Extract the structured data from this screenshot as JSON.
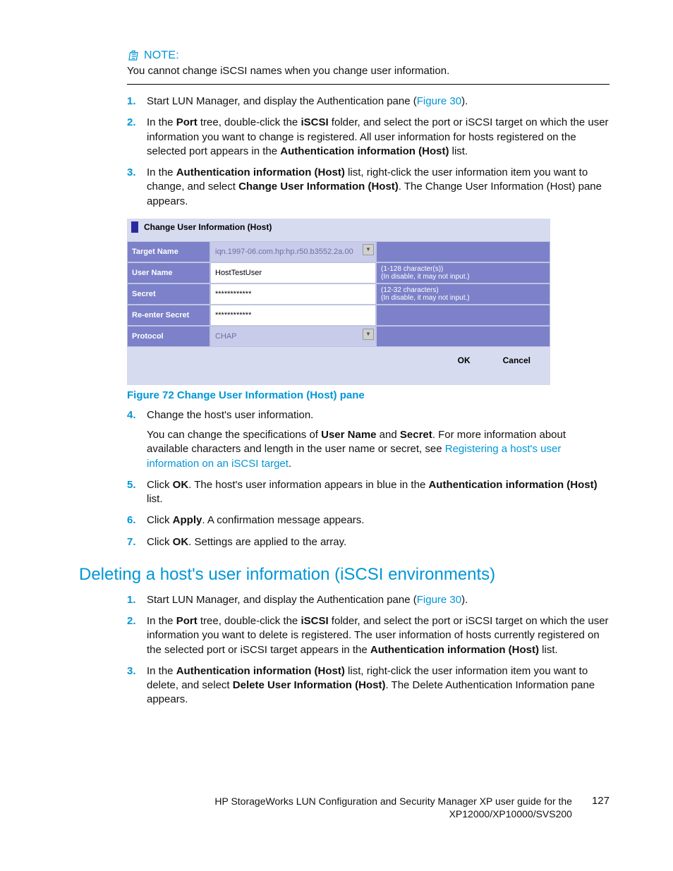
{
  "note": {
    "label": "NOTE:",
    "body": "You cannot change iSCSI names when you change user information."
  },
  "steps1": [
    {
      "num": "1.",
      "pre": "Start LUN Manager, and display the Authentication pane (",
      "link": "Figure 30",
      "post": ")."
    },
    {
      "num": "2.",
      "pre": "In the ",
      "b1": "Port",
      "mid1": " tree, double-click the ",
      "b2": "iSCSI",
      "mid2": " folder, and select the port or iSCSI target on which the user information you want to change is registered. All user information for hosts registered on the selected port appears in the ",
      "b3": "Authentication information (Host)",
      "post": " list."
    },
    {
      "num": "3.",
      "pre": "In the ",
      "b1": "Authentication information (Host)",
      "mid1": " list, right-click the user information item you want to change, and select ",
      "b2": "Change User Information (Host)",
      "post": ". The Change User Information (Host) pane appears."
    }
  ],
  "figure": {
    "title": "Change User Information (Host)",
    "rows": {
      "targetName": {
        "label": "Target Name",
        "value": "iqn.1997-06.com.hp:hp.r50.b3552.2a.00"
      },
      "userName": {
        "label": "User Name",
        "value": "HostTestUser",
        "hint1": "(1-128 character(s))",
        "hint2": "(In disable, it may not input.)"
      },
      "secret": {
        "label": "Secret",
        "value": "************",
        "hint1": "(12-32 characters)",
        "hint2": "(In disable, it may not input.)"
      },
      "reenter": {
        "label": "Re-enter Secret",
        "value": "************"
      },
      "protocol": {
        "label": "Protocol",
        "value": "CHAP"
      }
    },
    "ok": "OK",
    "cancel": "Cancel",
    "caption": "Figure 72 Change User Information (Host) pane"
  },
  "steps2": [
    {
      "num": "4.",
      "text": "Change the host's user information.",
      "p2_pre": "You can change the specifications of ",
      "p2_b1": "User Name",
      "p2_mid": " and ",
      "p2_b2": "Secret",
      "p2_mid2": ". For more information about available characters and length in the user name or secret, see ",
      "p2_link": "Registering a host's user information on an iSCSI target",
      "p2_post": "."
    },
    {
      "num": "5.",
      "pre": "Click ",
      "b1": "OK",
      "mid": ". The host's user information appears in blue in the ",
      "b2": "Authentication information (Host)",
      "post": " list."
    },
    {
      "num": "6.",
      "pre": "Click ",
      "b1": "Apply",
      "post": ". A confirmation message appears."
    },
    {
      "num": "7.",
      "pre": "Click ",
      "b1": "OK",
      "post": ". Settings are applied to the array."
    }
  ],
  "section2_title": "Deleting a host's user information (iSCSI environments)",
  "steps3": [
    {
      "num": "1.",
      "pre": "Start LUN Manager, and display the Authentication pane (",
      "link": "Figure 30",
      "post": ")."
    },
    {
      "num": "2.",
      "pre": "In the ",
      "b1": "Port",
      "mid1": " tree, double-click the ",
      "b2": "iSCSI",
      "mid2": " folder, and select the port or iSCSI target on which the user information you want to delete is registered. The user information of hosts currently registered on the selected port or iSCSI target appears in the ",
      "b3": "Authentication information (Host)",
      "post": " list."
    },
    {
      "num": "3.",
      "pre": "In the ",
      "b1": "Authentication information (Host)",
      "mid1": " list, right-click the user information item you want to delete, and select ",
      "b2": "Delete User Information (Host)",
      "post": ". The Delete Authentication Information pane appears."
    }
  ],
  "footer": {
    "line1": "HP StorageWorks LUN Configuration and Security Manager XP user guide for the",
    "line2": "XP12000/XP10000/SVS200",
    "page": "127"
  }
}
